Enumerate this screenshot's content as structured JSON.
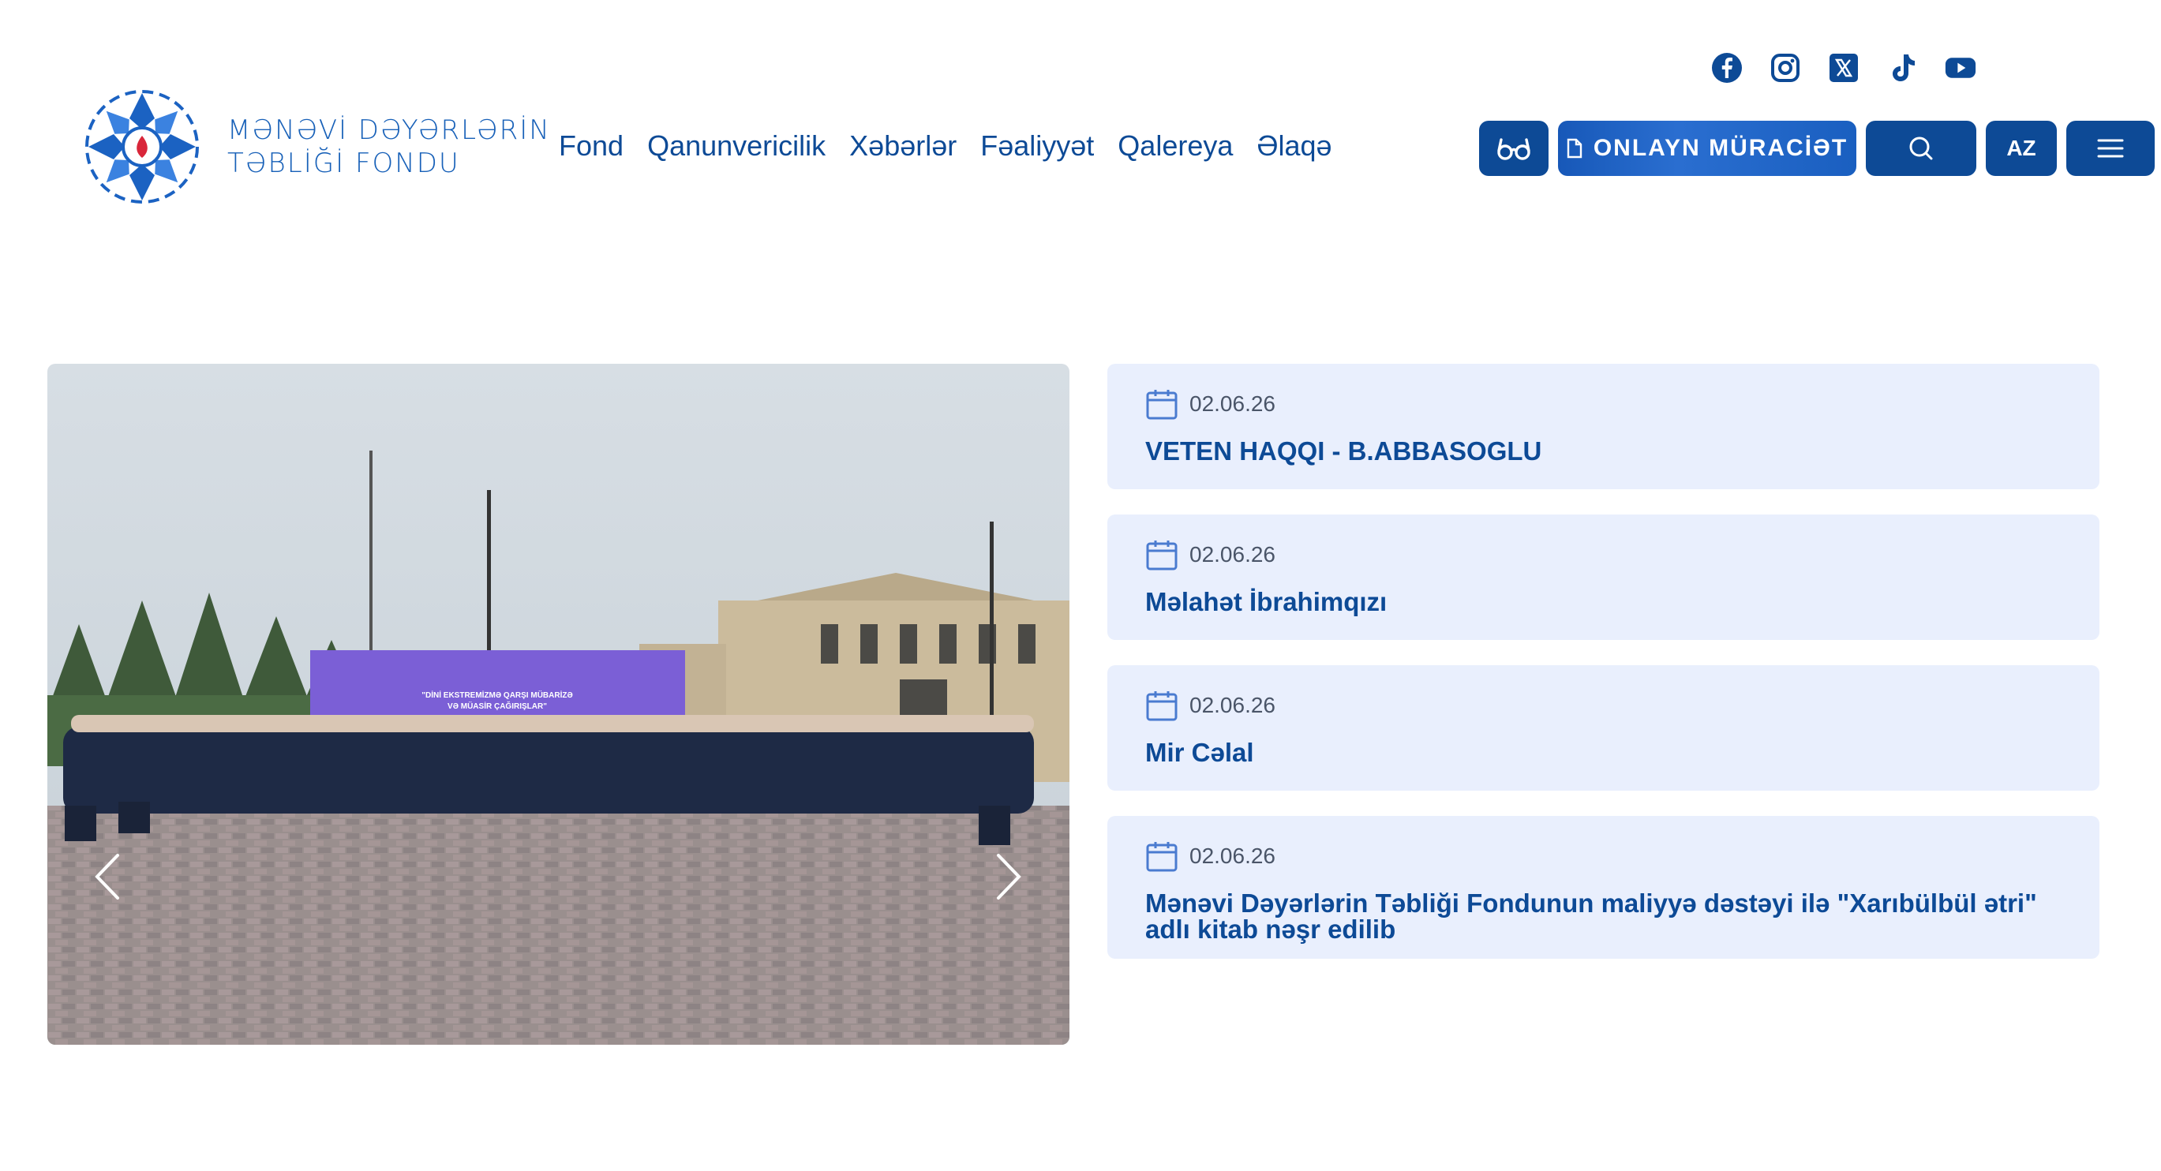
{
  "logo": {
    "line1": "MƏNƏVİ DƏYƏRLƏRİN",
    "line2": "TƏBLİĞİ FONDU",
    "icon": "foundation-logo-icon"
  },
  "nav": [
    {
      "label": "Fond"
    },
    {
      "label": "Qanunvericilik"
    },
    {
      "label": "Xəbərlər"
    },
    {
      "label": "Fəaliyyət"
    },
    {
      "label": "Qalereya"
    },
    {
      "label": "Əlaqə"
    }
  ],
  "socials": [
    "facebook-icon",
    "instagram-icon",
    "x-icon",
    "tiktok-icon",
    "youtube-icon"
  ],
  "actions": {
    "accessibility_icon": "glasses-icon",
    "apply_label": "ONLAYN MÜRACİƏT",
    "search_icon": "search-icon",
    "lang_label": "AZ",
    "menu_icon": "hamburger-icon"
  },
  "slider": {
    "banner_line1": "\"DİNİ EKSTREMİZMƏ QARŞI MÜBARİZƏ",
    "banner_line2": "VƏ MÜASİR ÇAĞIRIŞLAR\""
  },
  "news": [
    {
      "date": "02.06.26",
      "title": "VETEN HAQQI - B.ABBASOGLU"
    },
    {
      "date": "02.06.26",
      "title": "Məlahət İbrahimqızı"
    },
    {
      "date": "02.06.26",
      "title": "Mir Cəlal"
    },
    {
      "date": "02.06.26",
      "title": "Mənəvi Dəyərlərin Təbliği Fondunun maliyyə dəstəyi ilə \"Xarıbülbül ətri\" adlı kitab nəşr edilib"
    }
  ],
  "colors": {
    "primary": "#0d4a96",
    "card_bg": "#e9effd",
    "banner": "#7b5fd6"
  }
}
